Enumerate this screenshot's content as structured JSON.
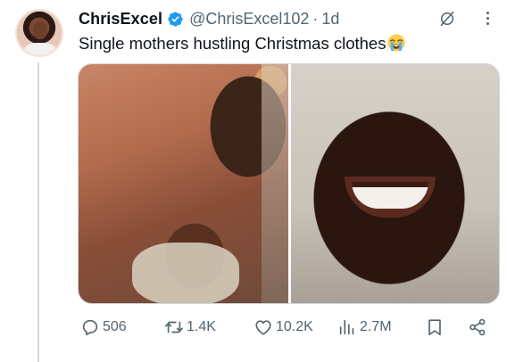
{
  "author": {
    "display_name": "ChrisExcel",
    "handle": "@ChrisExcel102",
    "time": "1d",
    "separator": "·",
    "verified": true,
    "verified_color": "#1d9bf0"
  },
  "tweet": {
    "text": "Single mothers hustling Christmas clothes",
    "emoji": "loudly-crying-face-emoji"
  },
  "media": {
    "count": 2,
    "photos": [
      "couple-in-bed-photo",
      "man-laughing-photo"
    ]
  },
  "actions": {
    "replies": "506",
    "reposts": "1.4K",
    "likes": "10.2K",
    "views": "2.7M"
  },
  "icons": [
    "grok-icon",
    "more-icon",
    "reply-icon",
    "repost-icon",
    "like-icon",
    "views-icon",
    "bookmark-icon",
    "share-icon"
  ],
  "colors": {
    "text": "#0f1419",
    "secondary_text": "#536471",
    "thread_line": "#cfd9de"
  }
}
